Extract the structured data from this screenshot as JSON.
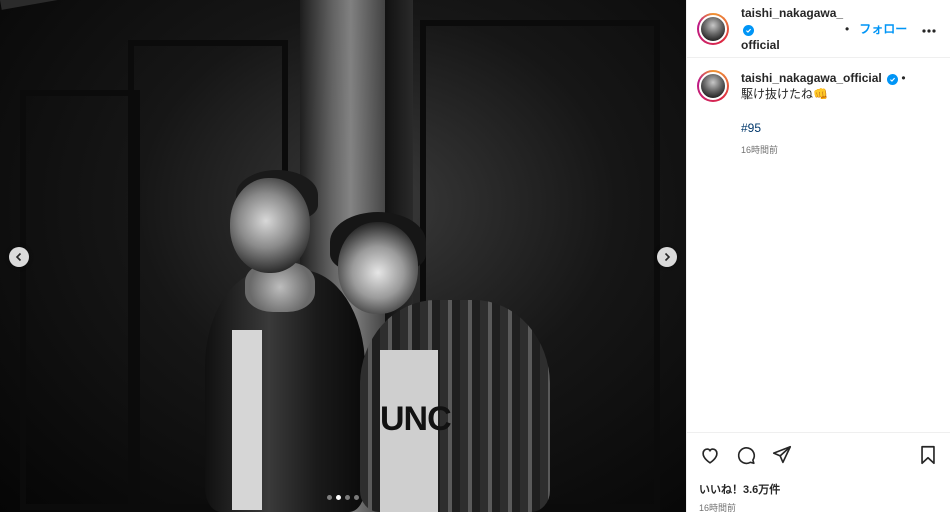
{
  "media": {
    "shirt_text": "UNC",
    "slides": 4,
    "active_slide": 2
  },
  "header": {
    "username_line1": "taishi_nakagawa_",
    "username_line2": "official",
    "follow_label": "フォロー",
    "separator": "•"
  },
  "caption": {
    "username": "taishi_nakagawa_official",
    "separator": "•",
    "text": "駆け抜けたね👊",
    "hashtag": "#95",
    "ago": "16時間前"
  },
  "footer": {
    "likes": "いいね！3.6万件",
    "time": "16時間前"
  },
  "colors": {
    "accent": "#0095f6",
    "hashtag": "#00376b",
    "text": "#262626",
    "muted": "#737373"
  },
  "icons": [
    "chevron-left-icon",
    "chevron-right-icon",
    "verified-badge-icon",
    "more-icon",
    "heart-icon",
    "comment-icon",
    "share-icon",
    "bookmark-icon"
  ]
}
